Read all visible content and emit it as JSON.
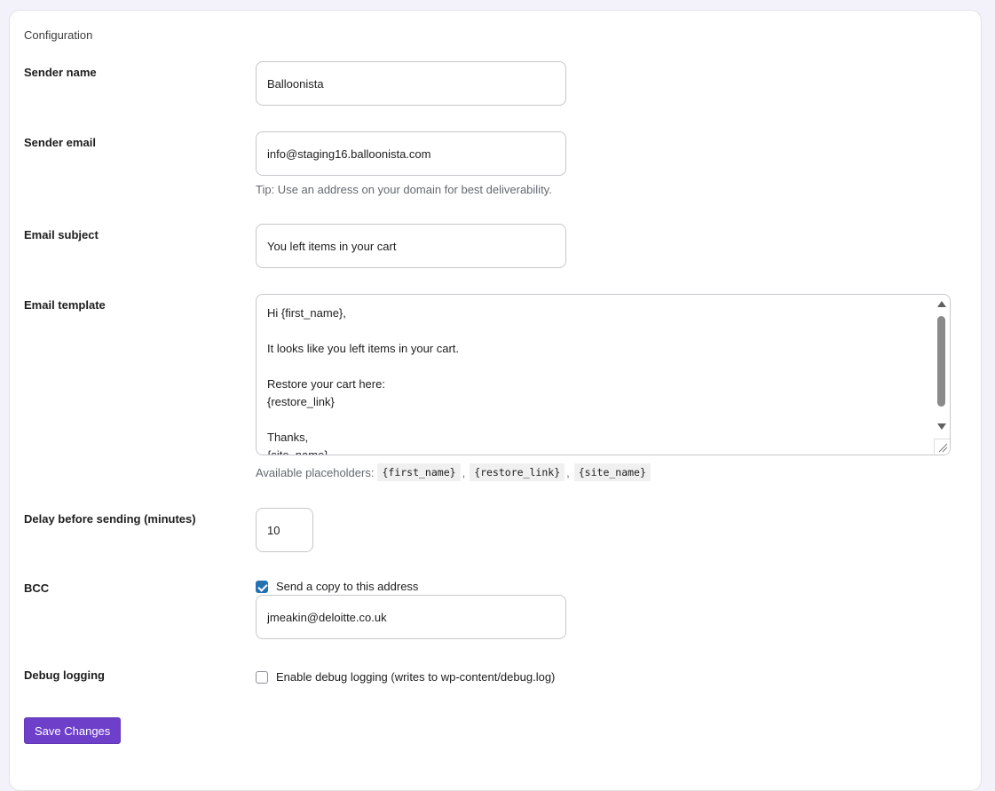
{
  "section": {
    "title": "Configuration"
  },
  "fields": {
    "sender_name": {
      "label": "Sender name",
      "value": "Balloonista"
    },
    "sender_email": {
      "label": "Sender email",
      "value": "info@staging16.balloonista.com",
      "help": "Tip: Use an address on your domain for best deliverability."
    },
    "email_subject": {
      "label": "Email subject",
      "value": "You left items in your cart"
    },
    "email_template": {
      "label": "Email template",
      "value": "Hi {first_name},\n\nIt looks like you left items in your cart.\n\nRestore your cart here:\n{restore_link}\n\nThanks,\n{site_name}",
      "placeholders_label": "Available placeholders:",
      "placeholders": [
        "{first_name}",
        "{restore_link}",
        "{site_name}"
      ],
      "separator": ","
    },
    "delay": {
      "label": "Delay before sending (minutes)",
      "value": "10"
    },
    "bcc": {
      "label": "BCC",
      "checkbox_label": "Send a copy to this address",
      "checked": true,
      "value": "jmeakin@deloitte.co.uk"
    },
    "debug": {
      "label": "Debug logging",
      "checkbox_label": "Enable debug logging (writes to wp-content/debug.log)",
      "checked": false
    }
  },
  "actions": {
    "save_label": "Save Changes"
  },
  "colors": {
    "primary_button": "#6e3fc9",
    "checkbox_checked": "#2271b1"
  }
}
